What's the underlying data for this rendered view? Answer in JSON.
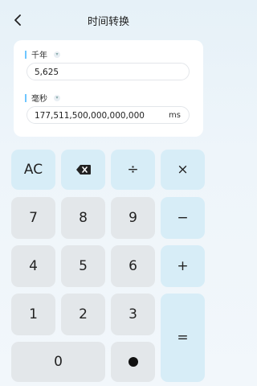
{
  "header": {
    "title": "时间转换",
    "back_icon": "chevron-left-icon"
  },
  "from": {
    "label": "千年",
    "value": "5,625"
  },
  "to": {
    "label": "毫秒",
    "value": "177,511,500,000,000,000",
    "unit": "ms"
  },
  "keypad": {
    "clear": "AC",
    "backspace_icon": "backspace-icon",
    "divide": "÷",
    "multiply": "×",
    "minus": "−",
    "plus": "+",
    "equals": "=",
    "digits": [
      "7",
      "8",
      "9",
      "4",
      "5",
      "6",
      "1",
      "2",
      "3",
      "0"
    ],
    "decimal_icon": "dot-icon"
  },
  "colors": {
    "accent": "#6ec6ff",
    "op_key": "#d7edf7",
    "num_key": "#e3e7ea"
  }
}
